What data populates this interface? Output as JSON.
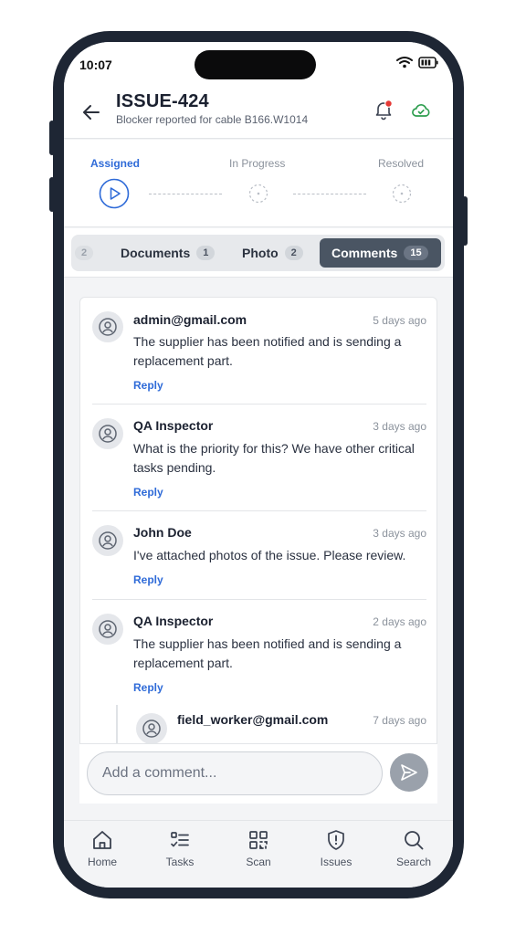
{
  "status_bar": {
    "time": "10:07"
  },
  "header": {
    "title": "ISSUE-424",
    "subtitle": "Blocker reported for cable B166.W1014"
  },
  "stepper": {
    "steps": [
      {
        "label": "Assigned",
        "state": "active"
      },
      {
        "label": "In Progress",
        "state": "pending"
      },
      {
        "label": "Resolved",
        "state": "pending"
      }
    ]
  },
  "tabs": [
    {
      "label": "",
      "count": "2"
    },
    {
      "label": "Documents",
      "count": "1"
    },
    {
      "label": "Photo",
      "count": "2"
    },
    {
      "label": "Comments",
      "count": "15",
      "active": true
    }
  ],
  "comments": [
    {
      "author": "admin@gmail.com",
      "time": "5 days ago",
      "text": "The supplier has been notified and is sending a replacement part.",
      "reply": "Reply"
    },
    {
      "author": "QA Inspector",
      "time": "3 days ago",
      "text": "What is the priority for this? We have other critical tasks pending.",
      "reply": "Reply"
    },
    {
      "author": "John Doe",
      "time": "3 days ago",
      "text": "I've attached photos of the issue. Please review.",
      "reply": "Reply"
    },
    {
      "author": "QA Inspector",
      "time": "2 days ago",
      "text": "The supplier has been notified and is sending a replacement part.",
      "reply": "Reply"
    },
    {
      "author": "field_worker@gmail.com",
      "time": "7 days ago",
      "text": "",
      "reply": ""
    }
  ],
  "composer": {
    "placeholder": "Add a comment..."
  },
  "bottom_nav": [
    {
      "label": "Home",
      "icon": "home-icon"
    },
    {
      "label": "Tasks",
      "icon": "tasks-icon"
    },
    {
      "label": "Scan",
      "icon": "qr-scan-icon"
    },
    {
      "label": "Issues",
      "icon": "shield-alert-icon"
    },
    {
      "label": "Search",
      "icon": "search-icon"
    }
  ],
  "colors": {
    "accent": "#2f6bd8",
    "active_tab": "#4a5563",
    "notification_dot": "#e53935",
    "sync_icon": "#2e9e4f"
  }
}
